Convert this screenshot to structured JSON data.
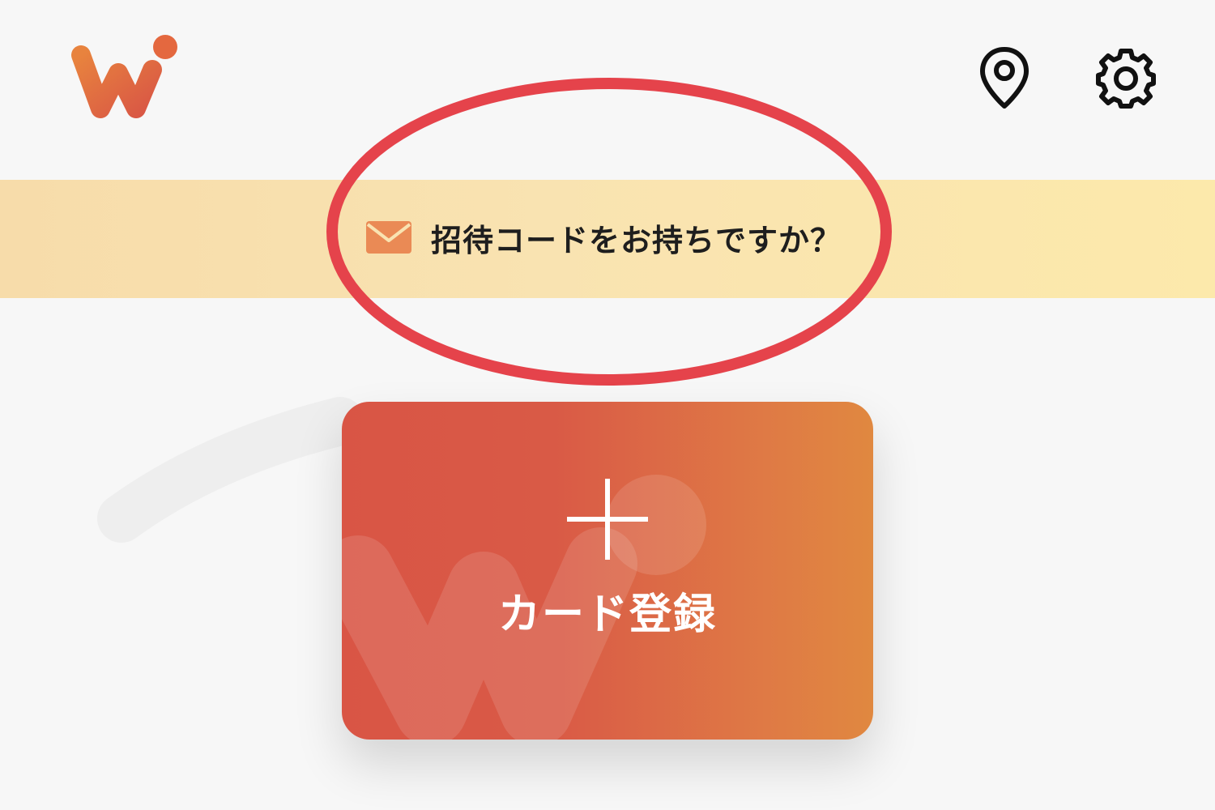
{
  "header": {
    "logo_icon": "wi-logo-icon",
    "location_icon": "map-pin-icon",
    "settings_icon": "gear-icon"
  },
  "invite_banner": {
    "icon": "mail-icon",
    "text": "招待コードをお持ちですか？"
  },
  "card": {
    "icon": "plus-icon",
    "label": "カード登録"
  },
  "colors": {
    "background": "#f7f7f7",
    "banner": "#f9e3b1",
    "card_start": "#d95545",
    "card_end": "#e08840",
    "highlight": "#e5434b"
  }
}
